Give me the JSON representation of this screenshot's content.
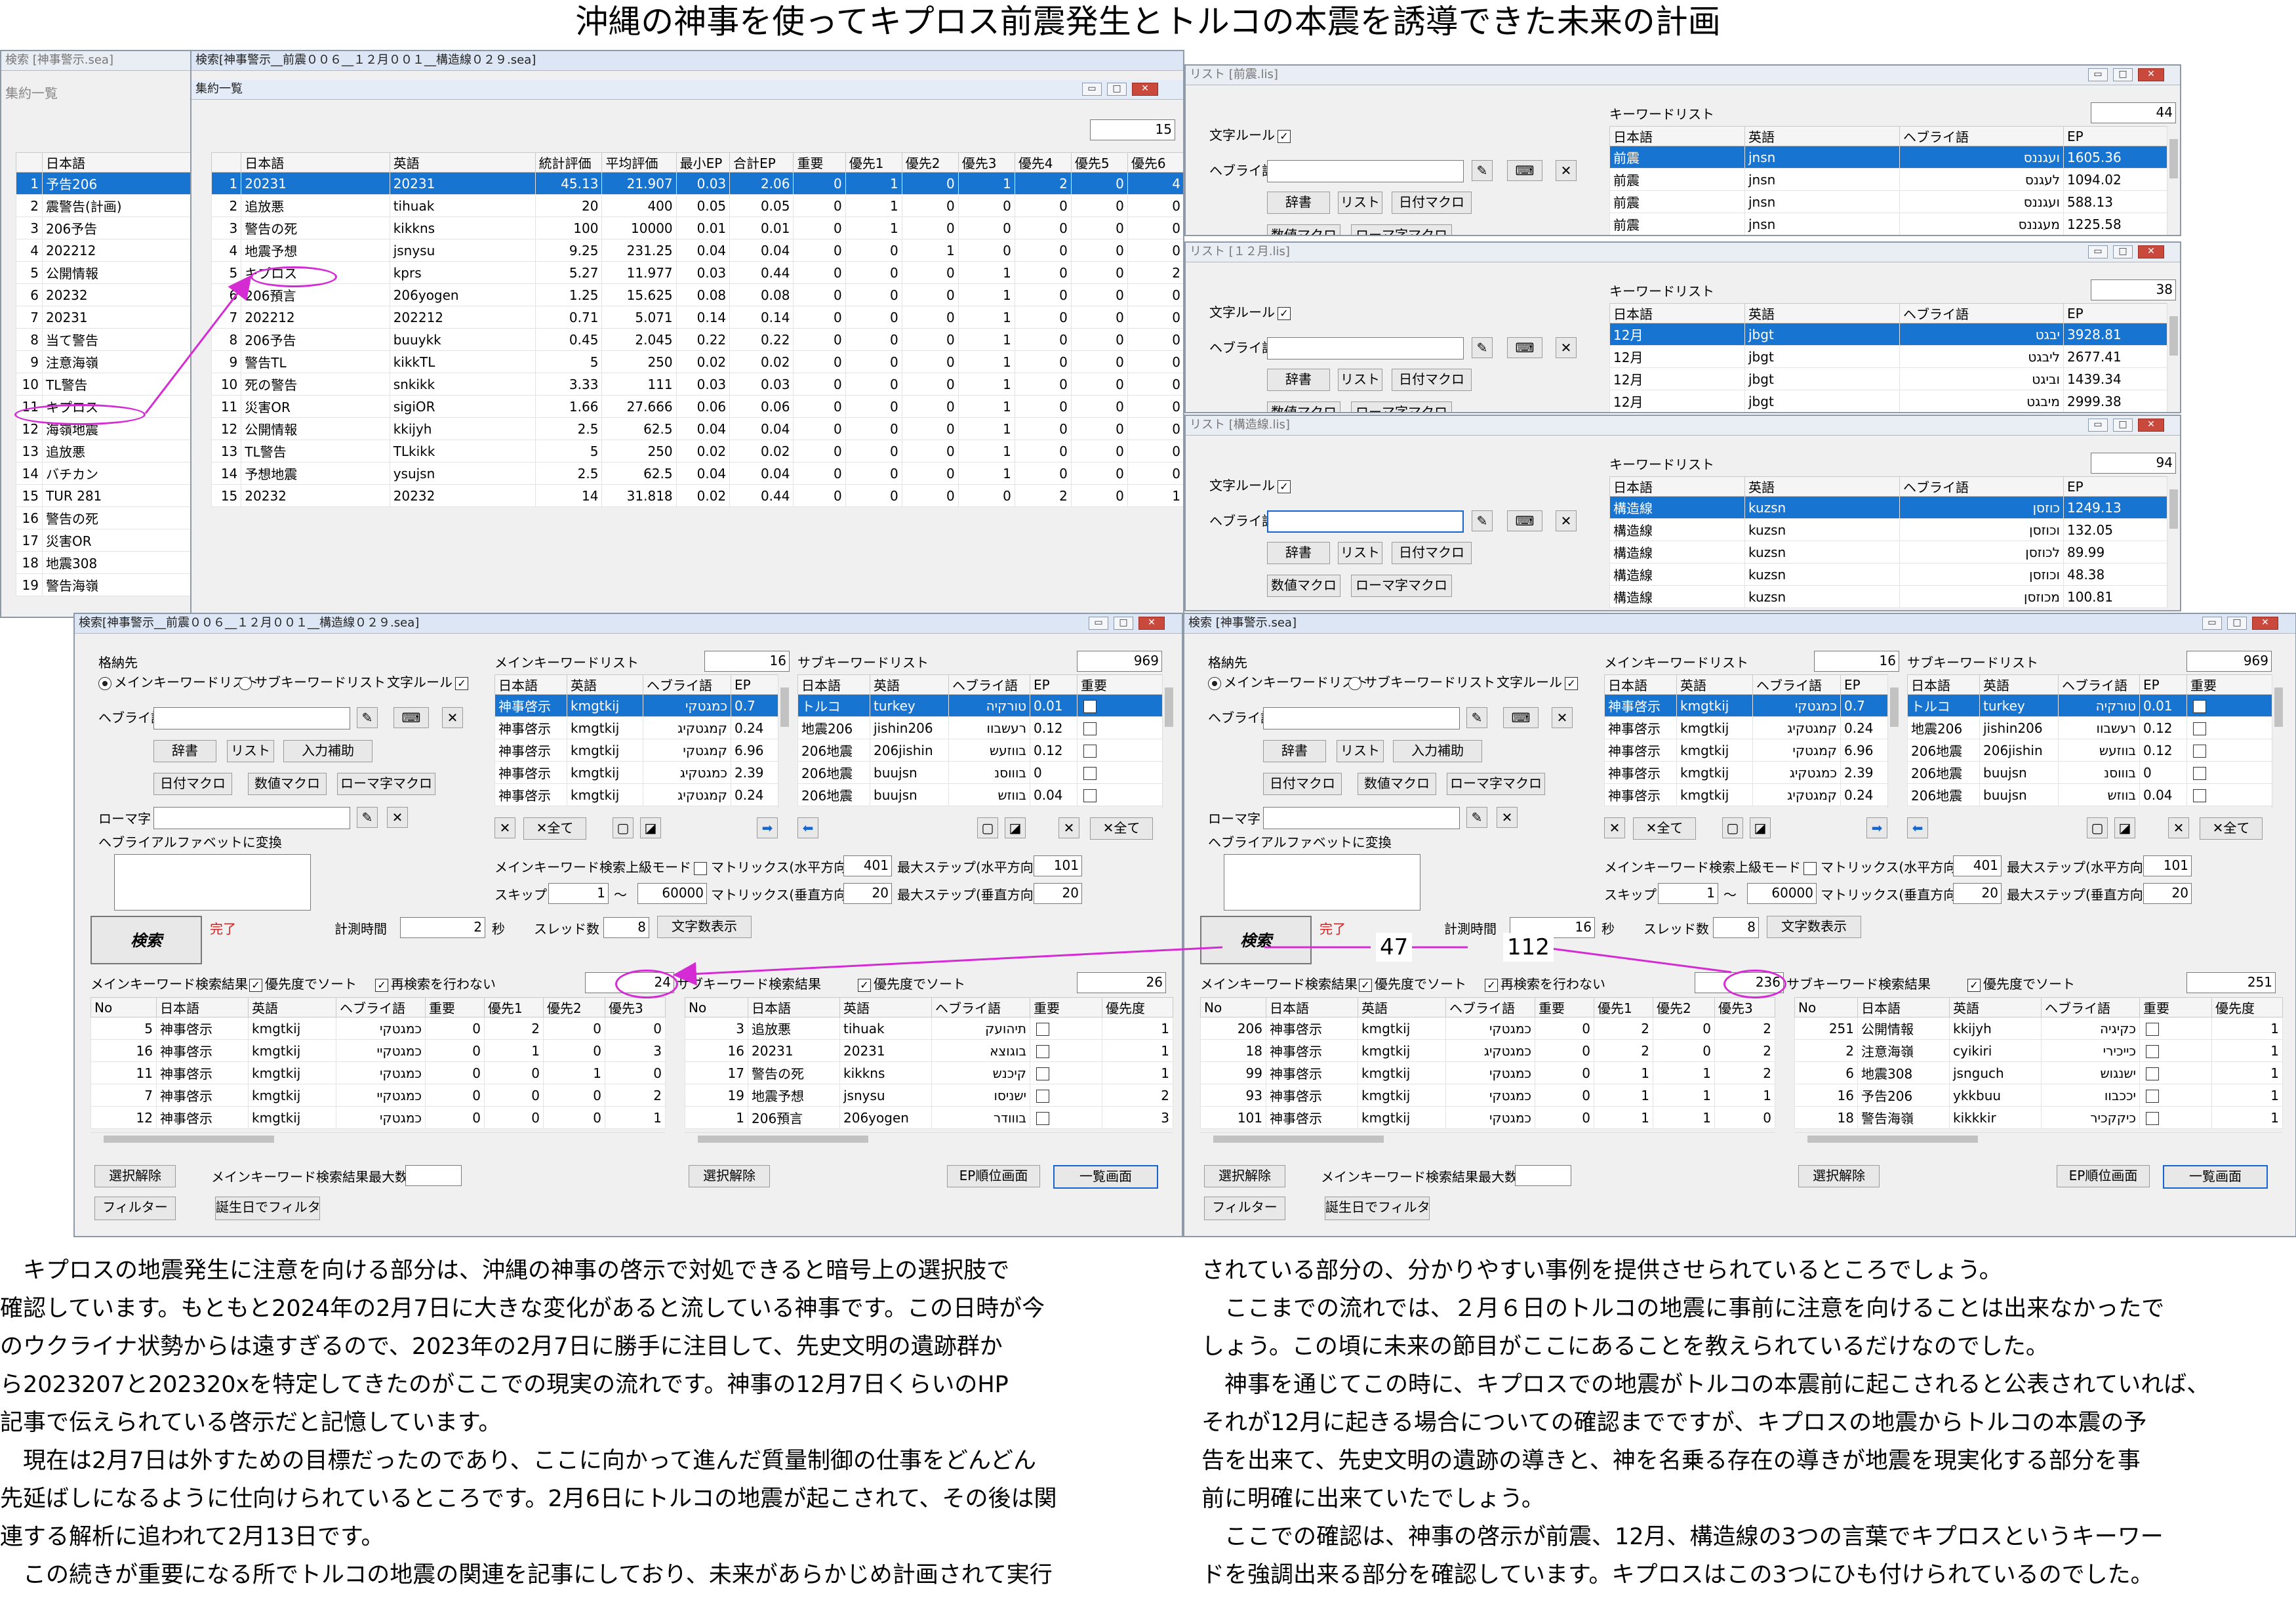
{
  "page_title": "沖縄の神事を使ってキプロス前震発生とトルコの本震を誘導できた未来の計画",
  "sidebar_win": {
    "title": "検索 [神事警示.sea]",
    "panel": "集約一覧",
    "header": "日本語",
    "rows": [
      [
        "1",
        "予告206"
      ],
      [
        "2",
        "震警告(計画)"
      ],
      [
        "3",
        "206予告"
      ],
      [
        "4",
        "202212"
      ],
      [
        "5",
        "公開情報"
      ],
      [
        "6",
        "20232"
      ],
      [
        "7",
        "20231"
      ],
      [
        "8",
        "当て警告"
      ],
      [
        "9",
        "注意海嶺"
      ],
      [
        "10",
        "TL警告"
      ],
      [
        "11",
        "キプロス"
      ],
      [
        "12",
        "海嶺地震"
      ],
      [
        "13",
        "追放悪"
      ],
      [
        "14",
        "バチカン"
      ],
      [
        "15",
        "TUR 281"
      ],
      [
        "16",
        "警告の死"
      ],
      [
        "17",
        "災害OR"
      ],
      [
        "18",
        "地震308"
      ],
      [
        "19",
        "警告海嶺"
      ]
    ]
  },
  "agg_win": {
    "title": "検索[神事警示__前震００６__１２月００１__構造線０２９.sea]",
    "panel": "集約一覧",
    "count": "15",
    "headers": [
      "",
      "日本語",
      "英語",
      "統計評価",
      "平均評価",
      "最小EP",
      "合計EP",
      "重要",
      "優先1",
      "優先2",
      "優先3",
      "優先4",
      "優先5",
      "優先6"
    ],
    "rows": [
      [
        "1",
        "20231",
        "20231",
        "45.13",
        "21.907",
        "0.03",
        "2.06",
        "0",
        "1",
        "0",
        "1",
        "2",
        "0",
        "4"
      ],
      [
        "2",
        "追放悪",
        "tihuak",
        "20",
        "400",
        "0.05",
        "0.05",
        "0",
        "1",
        "0",
        "0",
        "0",
        "0",
        "0"
      ],
      [
        "3",
        "警告の死",
        "kikkns",
        "100",
        "10000",
        "0.01",
        "0.01",
        "0",
        "1",
        "0",
        "0",
        "0",
        "0",
        "0"
      ],
      [
        "4",
        "地震予想",
        "jsnysu",
        "9.25",
        "231.25",
        "0.04",
        "0.04",
        "0",
        "0",
        "1",
        "0",
        "0",
        "0",
        "0"
      ],
      [
        "5",
        "キプロス",
        "kprs",
        "5.27",
        "11.977",
        "0.03",
        "0.44",
        "0",
        "0",
        "0",
        "1",
        "0",
        "0",
        "2"
      ],
      [
        "6",
        "206預言",
        "206yogen",
        "1.25",
        "15.625",
        "0.08",
        "0.08",
        "0",
        "0",
        "0",
        "1",
        "0",
        "0",
        "0"
      ],
      [
        "7",
        "202212",
        "202212",
        "0.71",
        "5.071",
        "0.14",
        "0.14",
        "0",
        "0",
        "0",
        "1",
        "0",
        "0",
        "0"
      ],
      [
        "8",
        "206予告",
        "buuykk",
        "0.45",
        "2.045",
        "0.22",
        "0.22",
        "0",
        "0",
        "0",
        "1",
        "0",
        "0",
        "0"
      ],
      [
        "9",
        "警告TL",
        "kikkTL",
        "5",
        "250",
        "0.02",
        "0.02",
        "0",
        "0",
        "0",
        "1",
        "0",
        "0",
        "0"
      ],
      [
        "10",
        "死の警告",
        "snkikk",
        "3.33",
        "111",
        "0.03",
        "0.03",
        "0",
        "0",
        "0",
        "1",
        "0",
        "0",
        "0"
      ],
      [
        "11",
        "災害OR",
        "sigiOR",
        "1.66",
        "27.666",
        "0.06",
        "0.06",
        "0",
        "0",
        "0",
        "1",
        "0",
        "0",
        "0"
      ],
      [
        "12",
        "公開情報",
        "kkijyh",
        "2.5",
        "62.5",
        "0.04",
        "0.04",
        "0",
        "0",
        "0",
        "1",
        "0",
        "0",
        "0"
      ],
      [
        "13",
        "TL警告",
        "TLkikk",
        "5",
        "250",
        "0.02",
        "0.02",
        "0",
        "0",
        "0",
        "1",
        "0",
        "0",
        "0"
      ],
      [
        "14",
        "予想地震",
        "ysujsn",
        "2.5",
        "62.5",
        "0.04",
        "0.04",
        "0",
        "0",
        "0",
        "1",
        "0",
        "0",
        "0"
      ],
      [
        "15",
        "20232",
        "20232",
        "14",
        "31.818",
        "0.02",
        "0.44",
        "0",
        "0",
        "0",
        "0",
        "2",
        "0",
        "1"
      ]
    ]
  },
  "lists": [
    {
      "title": "リスト [前震.lis]",
      "kw_label": "キーワードリスト",
      "count": "44",
      "moji_rule": "文字ルール",
      "hebrew_label": "ヘブライ語",
      "btns": [
        "辞書",
        "リスト",
        "日付マクロ",
        "数値マクロ",
        "ローマ字マクロ"
      ],
      "headers": [
        "日本語",
        "英語",
        "ヘブライ語",
        "EP"
      ],
      "rows": [
        [
          "前震",
          "jnsn",
          "ועגננס",
          "1605.36"
        ],
        [
          "前震",
          "jnsn",
          "לעגנס",
          "1094.02"
        ],
        [
          "前震",
          "jnsn",
          "ועגננס",
          "588.13"
        ],
        [
          "前震",
          "jnsn",
          "מעגננס",
          "1225.58"
        ]
      ]
    },
    {
      "title": "リスト [１２月.lis]",
      "kw_label": "キーワードリスト",
      "count": "38",
      "moji_rule": "文字ルール",
      "hebrew_label": "ヘブライ語",
      "btns": [
        "辞書",
        "リスト",
        "日付マクロ",
        "数値マクロ",
        "ローマ字マクロ"
      ],
      "headers": [
        "日本語",
        "英語",
        "ヘブライ語",
        "EP"
      ],
      "rows": [
        [
          "12月",
          "jbgt",
          "יבגט",
          "3928.81"
        ],
        [
          "12月",
          "jbgt",
          "ליבגט",
          "2677.41"
        ],
        [
          "12月",
          "jbgt",
          "וביגט",
          "1439.34"
        ],
        [
          "12月",
          "jbgt",
          "מיבגט",
          "2999.38"
        ]
      ]
    },
    {
      "title": "リスト [構造線.lis]",
      "kw_label": "キーワードリスト",
      "count": "94",
      "moji_rule": "文字ルール",
      "hebrew_label": "ヘブライ語",
      "btns": [
        "辞書",
        "リスト",
        "日付マクロ",
        "数値マクロ",
        "ローマ字マクロ"
      ],
      "headers": [
        "日本語",
        "英語",
        "ヘブライ語",
        "EP"
      ],
      "rows": [
        [
          "構造線",
          "kuzsn",
          "כוזסן",
          "1249.13"
        ],
        [
          "構造線",
          "kuzsn",
          "וכוזסן",
          "132.05"
        ],
        [
          "構造線",
          "kuzsn",
          "לכוזסן",
          "89.99"
        ],
        [
          "構造線",
          "kuzsn",
          "וכוזסן",
          "48.38"
        ],
        [
          "構造線",
          "kuzsn",
          "מכוזסן",
          "100.81"
        ]
      ]
    }
  ],
  "search_wins": [
    {
      "title": "検索[神事警示__前震００６__１２月００１__構造線０２９.sea]",
      "time": "2",
      "main_res_count": "24",
      "sub_res_count": "26",
      "sub_list_count": "969",
      "main_res": [
        [
          "5",
          "神事啓示",
          "kmgtkij",
          "כמגטקי",
          "0",
          "2",
          "0",
          "0"
        ],
        [
          "16",
          "神事啓示",
          "kmgtkij",
          "כמגטקיי",
          "0",
          "1",
          "0",
          "3"
        ],
        [
          "11",
          "神事啓示",
          "kmgtkij",
          "כמגטקי",
          "0",
          "0",
          "1",
          "0"
        ],
        [
          "7",
          "神事啓示",
          "kmgtkij",
          "כמגטקיי",
          "0",
          "0",
          "0",
          "2"
        ],
        [
          "12",
          "神事啓示",
          "kmgtkij",
          "כמגטקי",
          "0",
          "0",
          "0",
          "1"
        ]
      ],
      "sub_res": [
        [
          "3",
          "追放悪",
          "tihuak",
          "תיהועק",
          "",
          "1"
        ],
        [
          "16",
          "20231",
          "20231",
          "בוגוצא",
          "",
          "1"
        ],
        [
          "17",
          "警告の死",
          "kikkns",
          "קיכנש",
          "",
          "1"
        ],
        [
          "19",
          "地震予想",
          "jsnysu",
          "ישניסו",
          "",
          "2"
        ],
        [
          "1",
          "206預言",
          "206yogen",
          "בווודר",
          "",
          "3"
        ]
      ]
    },
    {
      "title": "検索 [神事警示.sea]",
      "time": "16",
      "main_res_count": "236",
      "sub_res_count": "251",
      "sub_list_count": "969",
      "main_res": [
        [
          "206",
          "神事啓示",
          "kmgtkij",
          "כמגטקי",
          "0",
          "2",
          "0",
          "2"
        ],
        [
          "18",
          "神事啓示",
          "kmgtkij",
          "כמגטקיג",
          "0",
          "2",
          "0",
          "2"
        ],
        [
          "99",
          "神事啓示",
          "kmgtkij",
          "כמגטקי",
          "0",
          "1",
          "1",
          "2"
        ],
        [
          "93",
          "神事啓示",
          "kmgtkij",
          "כמגטקי",
          "0",
          "1",
          "1",
          "1"
        ],
        [
          "101",
          "神事啓示",
          "kmgtkij",
          "כמגטקי",
          "0",
          "1",
          "1",
          "0"
        ]
      ],
      "sub_res": [
        [
          "251",
          "公開情報",
          "kkijyh",
          "כקיגיה",
          "",
          "1"
        ],
        [
          "2",
          "注意海嶺",
          "cyikiri",
          "כייכירי",
          "",
          "1"
        ],
        [
          "6",
          "地震308",
          "jsnguch",
          "ישנגוש",
          "",
          "1"
        ],
        [
          "16",
          "予告206",
          "ykkbuu",
          "יככבוו",
          "",
          "1"
        ],
        [
          "18",
          "警告海嶺",
          "kikkkir",
          "כיקקכיר",
          "",
          "1"
        ]
      ]
    }
  ],
  "sw_common": {
    "kakuno": "格納先",
    "radio_main": "メインキーワードリスト",
    "radio_sub": "サブキーワードリスト",
    "moji_rule": "文字ルール",
    "hebrew_label": "ヘブライ語",
    "btn_jisho": "辞書",
    "btn_list": "リスト",
    "btn_nyuryoku": "入力補助",
    "btn_date": "日付マクロ",
    "btn_num": "数値マクロ",
    "btn_roma": "ローマ字マクロ",
    "roma_label": "ローマ字",
    "conv_label": "ヘブライアルファベットに変換",
    "main_list_label": "メインキーワードリスト",
    "main_list_count": "16",
    "sub_list_label": "サブキーワードリスト",
    "kw_headers": [
      "日本語",
      "英語",
      "ヘブライ語",
      "EP"
    ],
    "sub_kw_headers": [
      "日本語",
      "英語",
      "ヘブライ語",
      "EP",
      "重要"
    ],
    "main_kw": [
      [
        "神事啓示",
        "kmgtkij",
        "כמגטקי",
        "0.7"
      ],
      [
        "神事啓示",
        "kmgtkij",
        "קמגטקיג",
        "0.24"
      ],
      [
        "神事啓示",
        "kmgtkij",
        "קמגטקי",
        "6.96"
      ],
      [
        "神事啓示",
        "kmgtkij",
        "כמגטקיג",
        "2.39"
      ],
      [
        "神事啓示",
        "kmgtkij",
        "קמגטקיג",
        "0.24"
      ]
    ],
    "sub_kw": [
      [
        "トルコ",
        "turkey",
        "טורקיה",
        "0.01"
      ],
      [
        "地震206",
        "jishin206",
        "רעשבוו",
        "0.12"
      ],
      [
        "206地震",
        "206jishin",
        "בווזעש",
        "0.12"
      ],
      [
        "206地震",
        "buujsn",
        "בוווסנ",
        "0"
      ],
      [
        "206地震",
        "buujsn",
        "בווזש",
        "0.04"
      ]
    ],
    "all_label": "全て",
    "upper_mode": "メインキーワード検索上級モード",
    "matrix_h": "マトリックス(水平方向)",
    "matrix_h_val": "401",
    "max_step_h": "最大ステップ(水平方向)",
    "max_step_h_val": "101",
    "skip": "スキップ",
    "skip_from": "1",
    "tilde": "～",
    "skip_to": "60000",
    "matrix_v": "マトリックス(垂直方向)",
    "matrix_v_val": "20",
    "max_step_v": "最大ステップ(垂直方向)",
    "max_step_v_val": "20",
    "search_btn": "検索",
    "done": "完了",
    "time_label": "計測時間",
    "sec": "秒",
    "thread_label": "スレッド数",
    "thread_val": "8",
    "char_btn": "文字数表示",
    "main_res_label": "メインキーワード検索結果",
    "priority_sort": "優先度でソート",
    "no_research": "再検索を行わない",
    "sub_res_label": "サブキーワード検索結果",
    "main_res_headers": [
      "No",
      "日本語",
      "英語",
      "ヘブライ語",
      "重要",
      "優先1",
      "優先2",
      "優先3"
    ],
    "sub_res_headers": [
      "No",
      "日本語",
      "英語",
      "ヘブライ語",
      "重要",
      "優先度"
    ],
    "deselect": "選択解除",
    "max_count_label": "メインキーワード検索結果最大数",
    "ep_rank": "EP順位画面",
    "list_screen": "一覧画面",
    "filter": "フィルター",
    "bday_filter": "誕生日でフィルタ"
  },
  "annotations": {
    "a47": "47",
    "a112": "112"
  },
  "text_left": [
    "キプロスの地震発生に注意を向ける部分は、沖縄の神事の啓示で対処できると暗号上の選択肢で",
    "確認しています。もともと2024年の2月7日に大きな変化があると流している神事です。この日時が今",
    "のウクライナ状勢からは遠すぎるので、2023年の2月7日に勝手に注目して、先史文明の遺跡群か",
    "ら2023207と202320xを特定してきたのがここでの現実の流れです。神事の12月7日くらいのHP",
    "記事で伝えられている啓示だと記憶しています。",
    "現在は2月7日は外すための目標だったのであり、ここに向かって進んだ質量制御の仕事をどんどん",
    "先延ばしになるように仕向けられているところです。2月6日にトルコの地震が起こされて、その後は関",
    "連する解析に追われて2月13日です。",
    "この続きが重要になる所でトルコの地震の関連を記事にしており、未来があらかじめ計画されて実行"
  ],
  "text_right": [
    "されている部分の、分かりやすい事例を提供させられているところでしょう。",
    "ここまでの流れでは、２月６日のトルコの地震に事前に注意を向けることは出来なかったで",
    "しょう。この頃に未来の節目がここにあることを教えられているだけなのでした。",
    "神事を通じてこの時に、キプロスでの地震がトルコの本震前に起こされると公表されていれば、",
    "それが12月に起きる場合についての確認までですが、キプロスの地震からトルコの本震の予",
    "告を出来て、先史文明の遺跡の導きと、神を名乗る存在の導きが地震を現実化する部分を事",
    "前に明確に出来ていたでしょう。",
    "ここでの確認は、神事の啓示が前震、12月、構造線の3つの言葉でキプロスというキーワー",
    "ドを強調出来る部分を確認しています。キプロスはこの3つにひも付けられているのでした。"
  ]
}
